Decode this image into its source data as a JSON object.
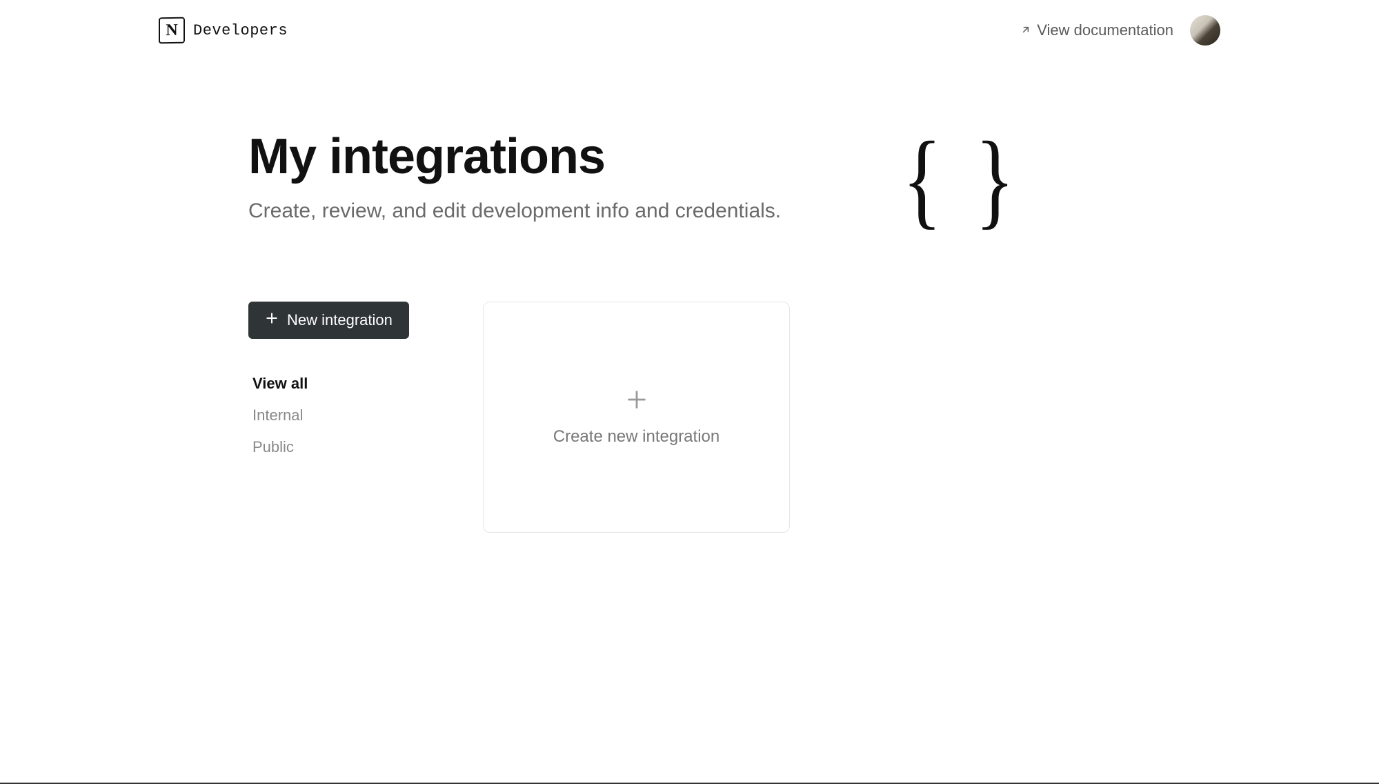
{
  "header": {
    "brand": "Developers",
    "doc_link_label": "View documentation"
  },
  "hero": {
    "title": "My integrations",
    "subtitle": "Create, review, and edit development info and credentials."
  },
  "sidebar": {
    "new_button_label": "New integration",
    "filters": [
      {
        "label": "View all",
        "active": true
      },
      {
        "label": "Internal",
        "active": false
      },
      {
        "label": "Public",
        "active": false
      }
    ]
  },
  "card": {
    "create_label": "Create new integration"
  }
}
